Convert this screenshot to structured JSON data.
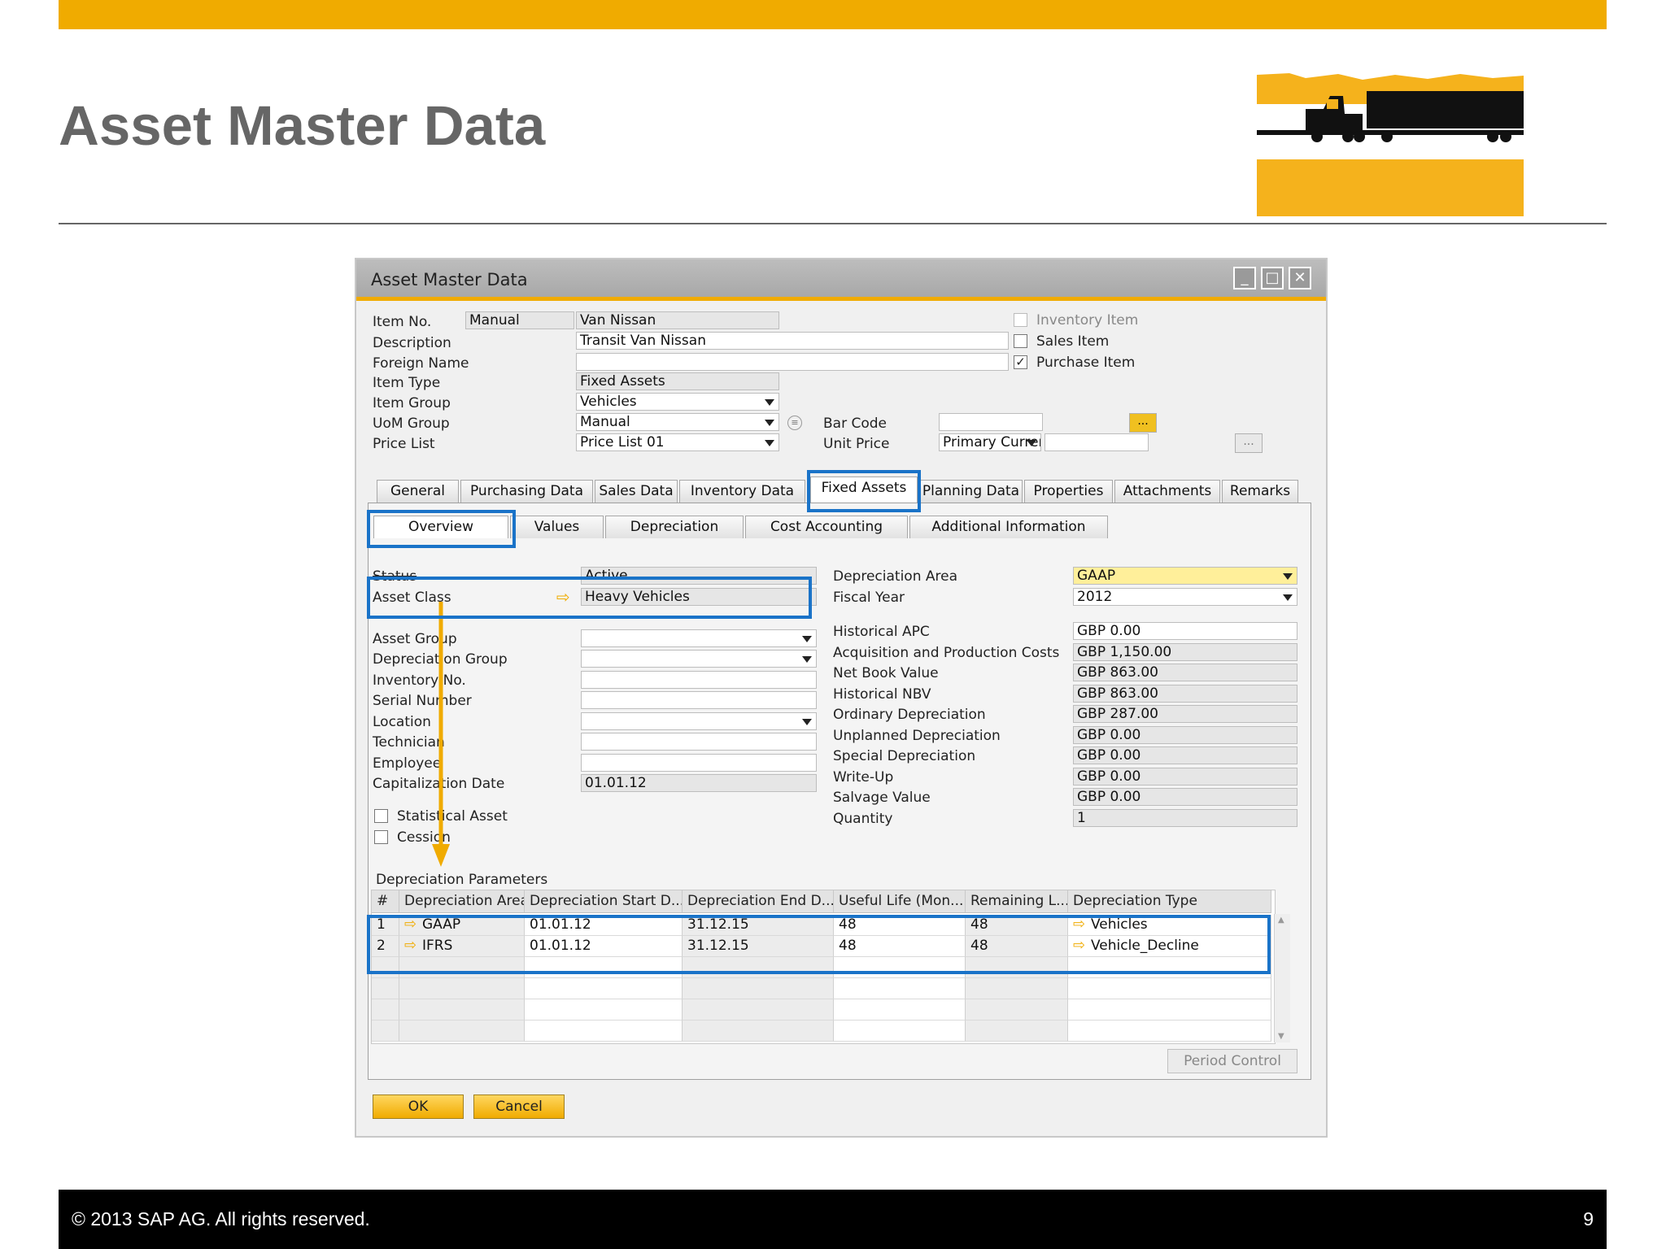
{
  "slide": {
    "title": "Asset Master Data",
    "footer_copyright": "© 2013 SAP AG. All rights reserved.",
    "page_number": "9",
    "accent_color": "#f0ab00",
    "highlight_color": "#1a73c8"
  },
  "window": {
    "title": "Asset Master Data",
    "controls": [
      "minimize-icon",
      "maximize-icon",
      "close-icon"
    ]
  },
  "header": {
    "item_no_label": "Item No.",
    "item_no_series": "Manual",
    "item_no_value": "Van Nissan",
    "description_label": "Description",
    "description_value": "Transit Van Nissan",
    "foreign_name_label": "Foreign Name",
    "foreign_name_value": "",
    "item_type_label": "Item Type",
    "item_type_value": "Fixed Assets",
    "item_group_label": "Item Group",
    "item_group_value": "Vehicles",
    "uom_group_label": "UoM Group",
    "uom_group_value": "Manual",
    "price_list_label": "Price List",
    "price_list_value": "Price List 01",
    "bar_code_label": "Bar Code",
    "bar_code_value": "",
    "unit_price_label": "Unit Price",
    "unit_price_currency": "Primary Currer",
    "unit_price_value": "",
    "inventory_item_label": "Inventory Item",
    "sales_item_label": "Sales Item",
    "purchase_item_label": "Purchase Item",
    "ellipsis": "..."
  },
  "tabs": [
    "General",
    "Purchasing Data",
    "Sales Data",
    "Inventory Data",
    "Fixed Assets",
    "Planning Data",
    "Properties",
    "Attachments",
    "Remarks"
  ],
  "subtabs": [
    "Overview",
    "Values",
    "Depreciation",
    "Cost Accounting",
    "Additional Information"
  ],
  "left_fields": {
    "status_label": "Status",
    "status_value": "Active",
    "asset_class_label": "Asset Class",
    "asset_class_value": "Heavy Vehicles",
    "asset_group_label": "Asset Group",
    "depreciation_group_label": "Depreciation Group",
    "inventory_no_label": "Inventory No.",
    "serial_number_label": "Serial Number",
    "location_label": "Location",
    "technician_label": "Technician",
    "employee_label": "Employee",
    "capitalization_date_label": "Capitalization Date",
    "capitalization_date_value": "01.01.12",
    "statistical_asset_label": "Statistical Asset",
    "cession_label": "Cession"
  },
  "right_fields": {
    "depreciation_area_label": "Depreciation Area",
    "depreciation_area_value": "GAAP",
    "fiscal_year_label": "Fiscal Year",
    "fiscal_year_value": "2012",
    "values": [
      {
        "label": "Historical APC",
        "value": "GBP 0.00"
      },
      {
        "label": "Acquisition and Production Costs",
        "value": "GBP 1,150.00"
      },
      {
        "label": "Net Book Value",
        "value": "GBP 863.00"
      },
      {
        "label": "Historical NBV",
        "value": "GBP 863.00"
      },
      {
        "label": "Ordinary Depreciation",
        "value": "GBP 287.00"
      },
      {
        "label": "Unplanned Depreciation",
        "value": "GBP 0.00"
      },
      {
        "label": "Special Depreciation",
        "value": "GBP 0.00"
      },
      {
        "label": "Write-Up",
        "value": "GBP 0.00"
      },
      {
        "label": "Salvage Value",
        "value": "GBP 0.00"
      },
      {
        "label": "Quantity",
        "value": "1"
      }
    ]
  },
  "depreciation_params": {
    "title": "Depreciation Parameters",
    "columns": [
      "#",
      "Depreciation Area",
      "Depreciation Start D...",
      "Depreciation End D...",
      "Useful Life (Mon...",
      "Remaining L...",
      "Depreciation Type"
    ],
    "rows": [
      [
        "1",
        "GAAP",
        "01.01.12",
        "31.12.15",
        "48",
        "48",
        "Vehicles"
      ],
      [
        "2",
        "IFRS",
        "01.01.12",
        "31.12.15",
        "48",
        "48",
        "Vehicle_Decline"
      ]
    ],
    "period_control_label": "Period Control"
  },
  "footer_buttons": {
    "ok": "OK",
    "cancel": "Cancel"
  }
}
